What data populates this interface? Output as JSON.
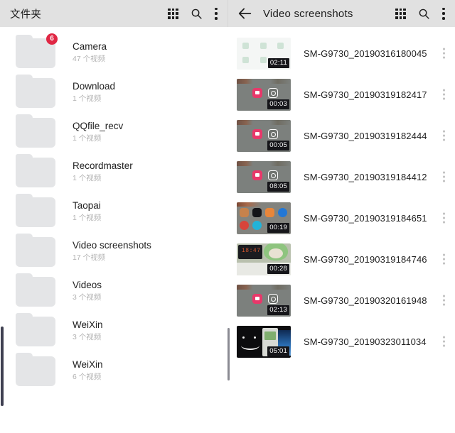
{
  "left_pane": {
    "appbar": {
      "title": "文件夹",
      "grid_icon": "grid-view-icon",
      "search_icon": "search-icon",
      "menu_icon": "more-options-icon"
    },
    "folders": [
      {
        "name": "Camera",
        "count": "47 个视频",
        "badge": "6"
      },
      {
        "name": "Download",
        "count": "1 个视频",
        "badge": ""
      },
      {
        "name": "QQfile_recv",
        "count": "1 个视频",
        "badge": ""
      },
      {
        "name": "Recordmaster",
        "count": "1 个视频",
        "badge": ""
      },
      {
        "name": "Taopai",
        "count": "1 个视频",
        "badge": ""
      },
      {
        "name": "Video screenshots",
        "count": "17 个视频",
        "badge": ""
      },
      {
        "name": "Videos",
        "count": "3 个视频",
        "badge": ""
      },
      {
        "name": "WeiXin",
        "count": "3 个视频",
        "badge": ""
      },
      {
        "name": "WeiXin",
        "count": "6 个视频",
        "badge": ""
      }
    ]
  },
  "right_pane": {
    "appbar": {
      "back_icon": "back-arrow-icon",
      "title": "Video screenshots",
      "grid_icon": "grid-view-icon",
      "search_icon": "search-icon",
      "menu_icon": "more-options-icon"
    },
    "videos": [
      {
        "name": "SM-G9730_20190316180045",
        "duration": "02:11",
        "thumb": "app-grid-light"
      },
      {
        "name": "SM-G9730_20190319182417",
        "duration": "00:03",
        "thumb": "home-screen-gray"
      },
      {
        "name": "SM-G9730_20190319182444",
        "duration": "00:05",
        "thumb": "home-screen-gray"
      },
      {
        "name": "SM-G9730_20190319184412",
        "duration": "08:05",
        "thumb": "home-screen-gray"
      },
      {
        "name": "SM-G9730_20190319184651",
        "duration": "00:19",
        "thumb": "app-icons-color"
      },
      {
        "name": "SM-G9730_20190319184746",
        "duration": "00:28",
        "thumb": "photo-clock-plush"
      },
      {
        "name": "SM-G9730_20190320161948",
        "duration": "02:13",
        "thumb": "home-screen-gray"
      },
      {
        "name": "SM-G9730_20190323011034",
        "duration": "05:01",
        "thumb": "dark-smiley"
      }
    ]
  },
  "colors": {
    "appbar_bg": "#e1e1e1",
    "badge_bg": "#e02744",
    "folder_icon": "#e4e5e7",
    "duration_bg": "#16161a",
    "scrollbar": "#3f4051"
  }
}
